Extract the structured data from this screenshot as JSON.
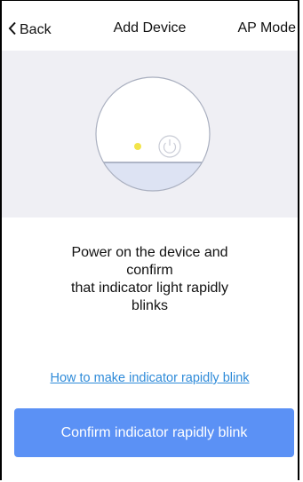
{
  "navbar": {
    "back_label": "Back",
    "title": "Add Device",
    "mode_label": "AP Mode"
  },
  "instruction": {
    "lines": [
      "Power on the device and",
      "confirm",
      "that indicator light rapidly",
      "blinks"
    ]
  },
  "help_link": "How to make indicator rapidly blink",
  "confirm_button": "Confirm indicator rapidly blink",
  "colors": {
    "hero_background": "#efeff4",
    "indicator_light": "#f2e44a",
    "link": "#2f8bd9",
    "button": "#5b91f5"
  }
}
